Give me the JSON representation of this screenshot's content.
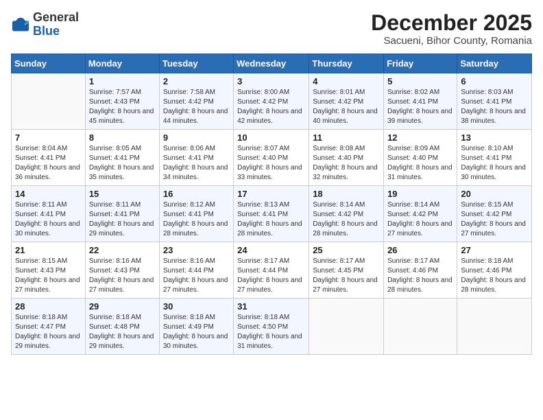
{
  "header": {
    "logo_general": "General",
    "logo_blue": "Blue",
    "month": "December 2025",
    "location": "Sacueni, Bihor County, Romania"
  },
  "weekdays": [
    "Sunday",
    "Monday",
    "Tuesday",
    "Wednesday",
    "Thursday",
    "Friday",
    "Saturday"
  ],
  "weeks": [
    [
      {
        "day": "",
        "sunrise": "",
        "sunset": "",
        "daylight": ""
      },
      {
        "day": "1",
        "sunrise": "Sunrise: 7:57 AM",
        "sunset": "Sunset: 4:43 PM",
        "daylight": "Daylight: 8 hours and 45 minutes."
      },
      {
        "day": "2",
        "sunrise": "Sunrise: 7:58 AM",
        "sunset": "Sunset: 4:42 PM",
        "daylight": "Daylight: 8 hours and 44 minutes."
      },
      {
        "day": "3",
        "sunrise": "Sunrise: 8:00 AM",
        "sunset": "Sunset: 4:42 PM",
        "daylight": "Daylight: 8 hours and 42 minutes."
      },
      {
        "day": "4",
        "sunrise": "Sunrise: 8:01 AM",
        "sunset": "Sunset: 4:42 PM",
        "daylight": "Daylight: 8 hours and 40 minutes."
      },
      {
        "day": "5",
        "sunrise": "Sunrise: 8:02 AM",
        "sunset": "Sunset: 4:41 PM",
        "daylight": "Daylight: 8 hours and 39 minutes."
      },
      {
        "day": "6",
        "sunrise": "Sunrise: 8:03 AM",
        "sunset": "Sunset: 4:41 PM",
        "daylight": "Daylight: 8 hours and 38 minutes."
      }
    ],
    [
      {
        "day": "7",
        "sunrise": "Sunrise: 8:04 AM",
        "sunset": "Sunset: 4:41 PM",
        "daylight": "Daylight: 8 hours and 36 minutes."
      },
      {
        "day": "8",
        "sunrise": "Sunrise: 8:05 AM",
        "sunset": "Sunset: 4:41 PM",
        "daylight": "Daylight: 8 hours and 35 minutes."
      },
      {
        "day": "9",
        "sunrise": "Sunrise: 8:06 AM",
        "sunset": "Sunset: 4:41 PM",
        "daylight": "Daylight: 8 hours and 34 minutes."
      },
      {
        "day": "10",
        "sunrise": "Sunrise: 8:07 AM",
        "sunset": "Sunset: 4:40 PM",
        "daylight": "Daylight: 8 hours and 33 minutes."
      },
      {
        "day": "11",
        "sunrise": "Sunrise: 8:08 AM",
        "sunset": "Sunset: 4:40 PM",
        "daylight": "Daylight: 8 hours and 32 minutes."
      },
      {
        "day": "12",
        "sunrise": "Sunrise: 8:09 AM",
        "sunset": "Sunset: 4:40 PM",
        "daylight": "Daylight: 8 hours and 31 minutes."
      },
      {
        "day": "13",
        "sunrise": "Sunrise: 8:10 AM",
        "sunset": "Sunset: 4:41 PM",
        "daylight": "Daylight: 8 hours and 30 minutes."
      }
    ],
    [
      {
        "day": "14",
        "sunrise": "Sunrise: 8:11 AM",
        "sunset": "Sunset: 4:41 PM",
        "daylight": "Daylight: 8 hours and 30 minutes."
      },
      {
        "day": "15",
        "sunrise": "Sunrise: 8:11 AM",
        "sunset": "Sunset: 4:41 PM",
        "daylight": "Daylight: 8 hours and 29 minutes."
      },
      {
        "day": "16",
        "sunrise": "Sunrise: 8:12 AM",
        "sunset": "Sunset: 4:41 PM",
        "daylight": "Daylight: 8 hours and 28 minutes."
      },
      {
        "day": "17",
        "sunrise": "Sunrise: 8:13 AM",
        "sunset": "Sunset: 4:41 PM",
        "daylight": "Daylight: 8 hours and 28 minutes."
      },
      {
        "day": "18",
        "sunrise": "Sunrise: 8:14 AM",
        "sunset": "Sunset: 4:42 PM",
        "daylight": "Daylight: 8 hours and 28 minutes."
      },
      {
        "day": "19",
        "sunrise": "Sunrise: 8:14 AM",
        "sunset": "Sunset: 4:42 PM",
        "daylight": "Daylight: 8 hours and 27 minutes."
      },
      {
        "day": "20",
        "sunrise": "Sunrise: 8:15 AM",
        "sunset": "Sunset: 4:42 PM",
        "daylight": "Daylight: 8 hours and 27 minutes."
      }
    ],
    [
      {
        "day": "21",
        "sunrise": "Sunrise: 8:15 AM",
        "sunset": "Sunset: 4:43 PM",
        "daylight": "Daylight: 8 hours and 27 minutes."
      },
      {
        "day": "22",
        "sunrise": "Sunrise: 8:16 AM",
        "sunset": "Sunset: 4:43 PM",
        "daylight": "Daylight: 8 hours and 27 minutes."
      },
      {
        "day": "23",
        "sunrise": "Sunrise: 8:16 AM",
        "sunset": "Sunset: 4:44 PM",
        "daylight": "Daylight: 8 hours and 27 minutes."
      },
      {
        "day": "24",
        "sunrise": "Sunrise: 8:17 AM",
        "sunset": "Sunset: 4:44 PM",
        "daylight": "Daylight: 8 hours and 27 minutes."
      },
      {
        "day": "25",
        "sunrise": "Sunrise: 8:17 AM",
        "sunset": "Sunset: 4:45 PM",
        "daylight": "Daylight: 8 hours and 27 minutes."
      },
      {
        "day": "26",
        "sunrise": "Sunrise: 8:17 AM",
        "sunset": "Sunset: 4:46 PM",
        "daylight": "Daylight: 8 hours and 28 minutes."
      },
      {
        "day": "27",
        "sunrise": "Sunrise: 8:18 AM",
        "sunset": "Sunset: 4:46 PM",
        "daylight": "Daylight: 8 hours and 28 minutes."
      }
    ],
    [
      {
        "day": "28",
        "sunrise": "Sunrise: 8:18 AM",
        "sunset": "Sunset: 4:47 PM",
        "daylight": "Daylight: 8 hours and 29 minutes."
      },
      {
        "day": "29",
        "sunrise": "Sunrise: 8:18 AM",
        "sunset": "Sunset: 4:48 PM",
        "daylight": "Daylight: 8 hours and 29 minutes."
      },
      {
        "day": "30",
        "sunrise": "Sunrise: 8:18 AM",
        "sunset": "Sunset: 4:49 PM",
        "daylight": "Daylight: 8 hours and 30 minutes."
      },
      {
        "day": "31",
        "sunrise": "Sunrise: 8:18 AM",
        "sunset": "Sunset: 4:50 PM",
        "daylight": "Daylight: 8 hours and 31 minutes."
      },
      {
        "day": "",
        "sunrise": "",
        "sunset": "",
        "daylight": ""
      },
      {
        "day": "",
        "sunrise": "",
        "sunset": "",
        "daylight": ""
      },
      {
        "day": "",
        "sunrise": "",
        "sunset": "",
        "daylight": ""
      }
    ]
  ]
}
